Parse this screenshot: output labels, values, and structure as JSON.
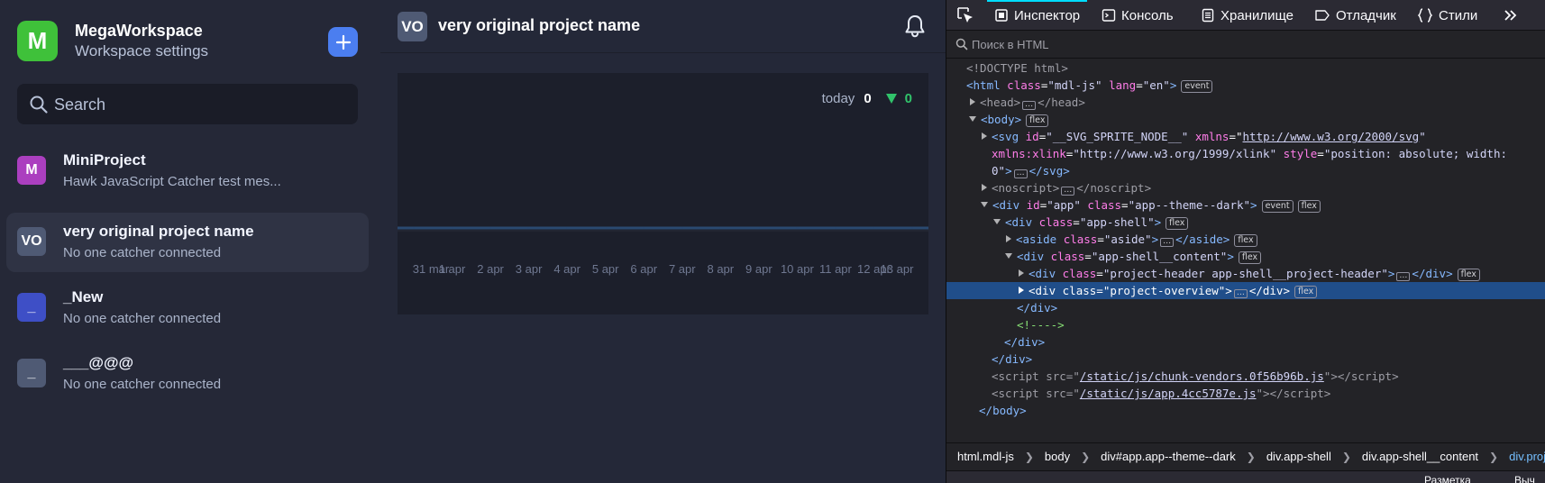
{
  "workspace": {
    "logo_letter": "M",
    "name": "MegaWorkspace",
    "subtitle": "Workspace settings",
    "logo_color": "#3fc13a",
    "add_button_color": "#4b7ef0"
  },
  "search": {
    "placeholder": "Search"
  },
  "projects": [
    {
      "avatar": "M",
      "title": "MiniProject",
      "subtitle": "Hawk JavaScript Catcher test mes...",
      "color": "#ab3fbf",
      "active": false
    },
    {
      "avatar": "VO",
      "title": "very original project name",
      "subtitle": "No one catcher connected",
      "color": "#4f5a74",
      "active": true
    },
    {
      "avatar": "_",
      "title": "_New",
      "subtitle": "No one catcher connected",
      "color": "#3e4fc6",
      "active": false
    },
    {
      "avatar": "_",
      "title": "___@@@",
      "subtitle": "No one catcher connected",
      "color": "#4f5a74",
      "active": false
    }
  ],
  "project_header": {
    "avatar": "VO",
    "title": "very original project name"
  },
  "chart_data": {
    "type": "line",
    "title": "",
    "xlabel": "",
    "ylabel": "",
    "categories": [
      "31 mar",
      "1 apr",
      "2 apr",
      "3 apr",
      "4 apr",
      "5 apr",
      "6 apr",
      "7 apr",
      "8 apr",
      "9 apr",
      "10 apr",
      "11 apr",
      "12 apr",
      "13 apr"
    ],
    "series": [
      {
        "values": [
          0,
          0,
          0,
          0,
          0,
          0,
          0,
          0,
          0,
          0,
          0,
          0,
          0,
          0
        ]
      }
    ],
    "grid": false,
    "line_color": "#2a4970"
  },
  "chart_stats": {
    "today_label": "today",
    "today_value": "0",
    "diff_value": "0",
    "diff_color": "#31c36b"
  },
  "devtools": {
    "tabs": [
      "Инспектор",
      "Консоль",
      "Хранилище",
      "Отладчик",
      "Стили"
    ],
    "search_placeholder": "Поиск в HTML",
    "markup": {
      "doctype": "<!DOCTYPE html>",
      "html_tag": "html",
      "html_class_attr": "class",
      "html_class_val": "\"mdl-js\"",
      "html_lang_attr": "lang",
      "html_lang_val": "\"en\"",
      "head_tag": "head",
      "body_tag": "body",
      "svg_tag": "svg",
      "svg_id_attr": "id",
      "svg_id_val": "\"__SVG_SPRITE_NODE__\"",
      "svg_xmlns_attr": "xmlns",
      "svg_xmlns_val": "http://www.w3.org/2000/svg",
      "svg_xlink_attr": "xmlns:xlink",
      "svg_xlink_val": "\"http://www.w3.org/1999/xlink\"",
      "svg_style_attr": "style",
      "svg_style_val": "\"position: absolute; width:",
      "svg_style_val2": "0\"",
      "noscript_tag": "noscript",
      "div_tag": "div",
      "app_id_attr": "id",
      "app_id_val": "\"app\"",
      "app_class_attr": "class",
      "app_class_val": "\"app--theme--dark\"",
      "shell_class_attr": "class",
      "shell_class_val": "\"app-shell\"",
      "aside_tag": "aside",
      "aside_class_attr": "class",
      "aside_class_val": "\"aside\"",
      "content_class_attr": "class",
      "content_class_val": "\"app-shell__content\"",
      "header_class_attr": "class",
      "header_class_val": "\"project-header app-shell__project-header\"",
      "overview_class_attr": "class",
      "overview_class_val": "\"project-overview\"",
      "comment": "<!---->",
      "script_tag": "script",
      "script_src_attr": "src",
      "script1_src": "/static/js/chunk-vendors.0f56b96b.js",
      "script2_src": "/static/js/app.4cc5787e.js",
      "badge_event": "event",
      "badge_flex": "flex"
    },
    "breadcrumb": [
      "html.mdl-js",
      "body",
      "div#app.app--theme--dark",
      "div.app-shell",
      "div.app-shell__content",
      "div.project-o"
    ],
    "bottom_tabs": [
      "Разметка",
      "Выч"
    ]
  }
}
